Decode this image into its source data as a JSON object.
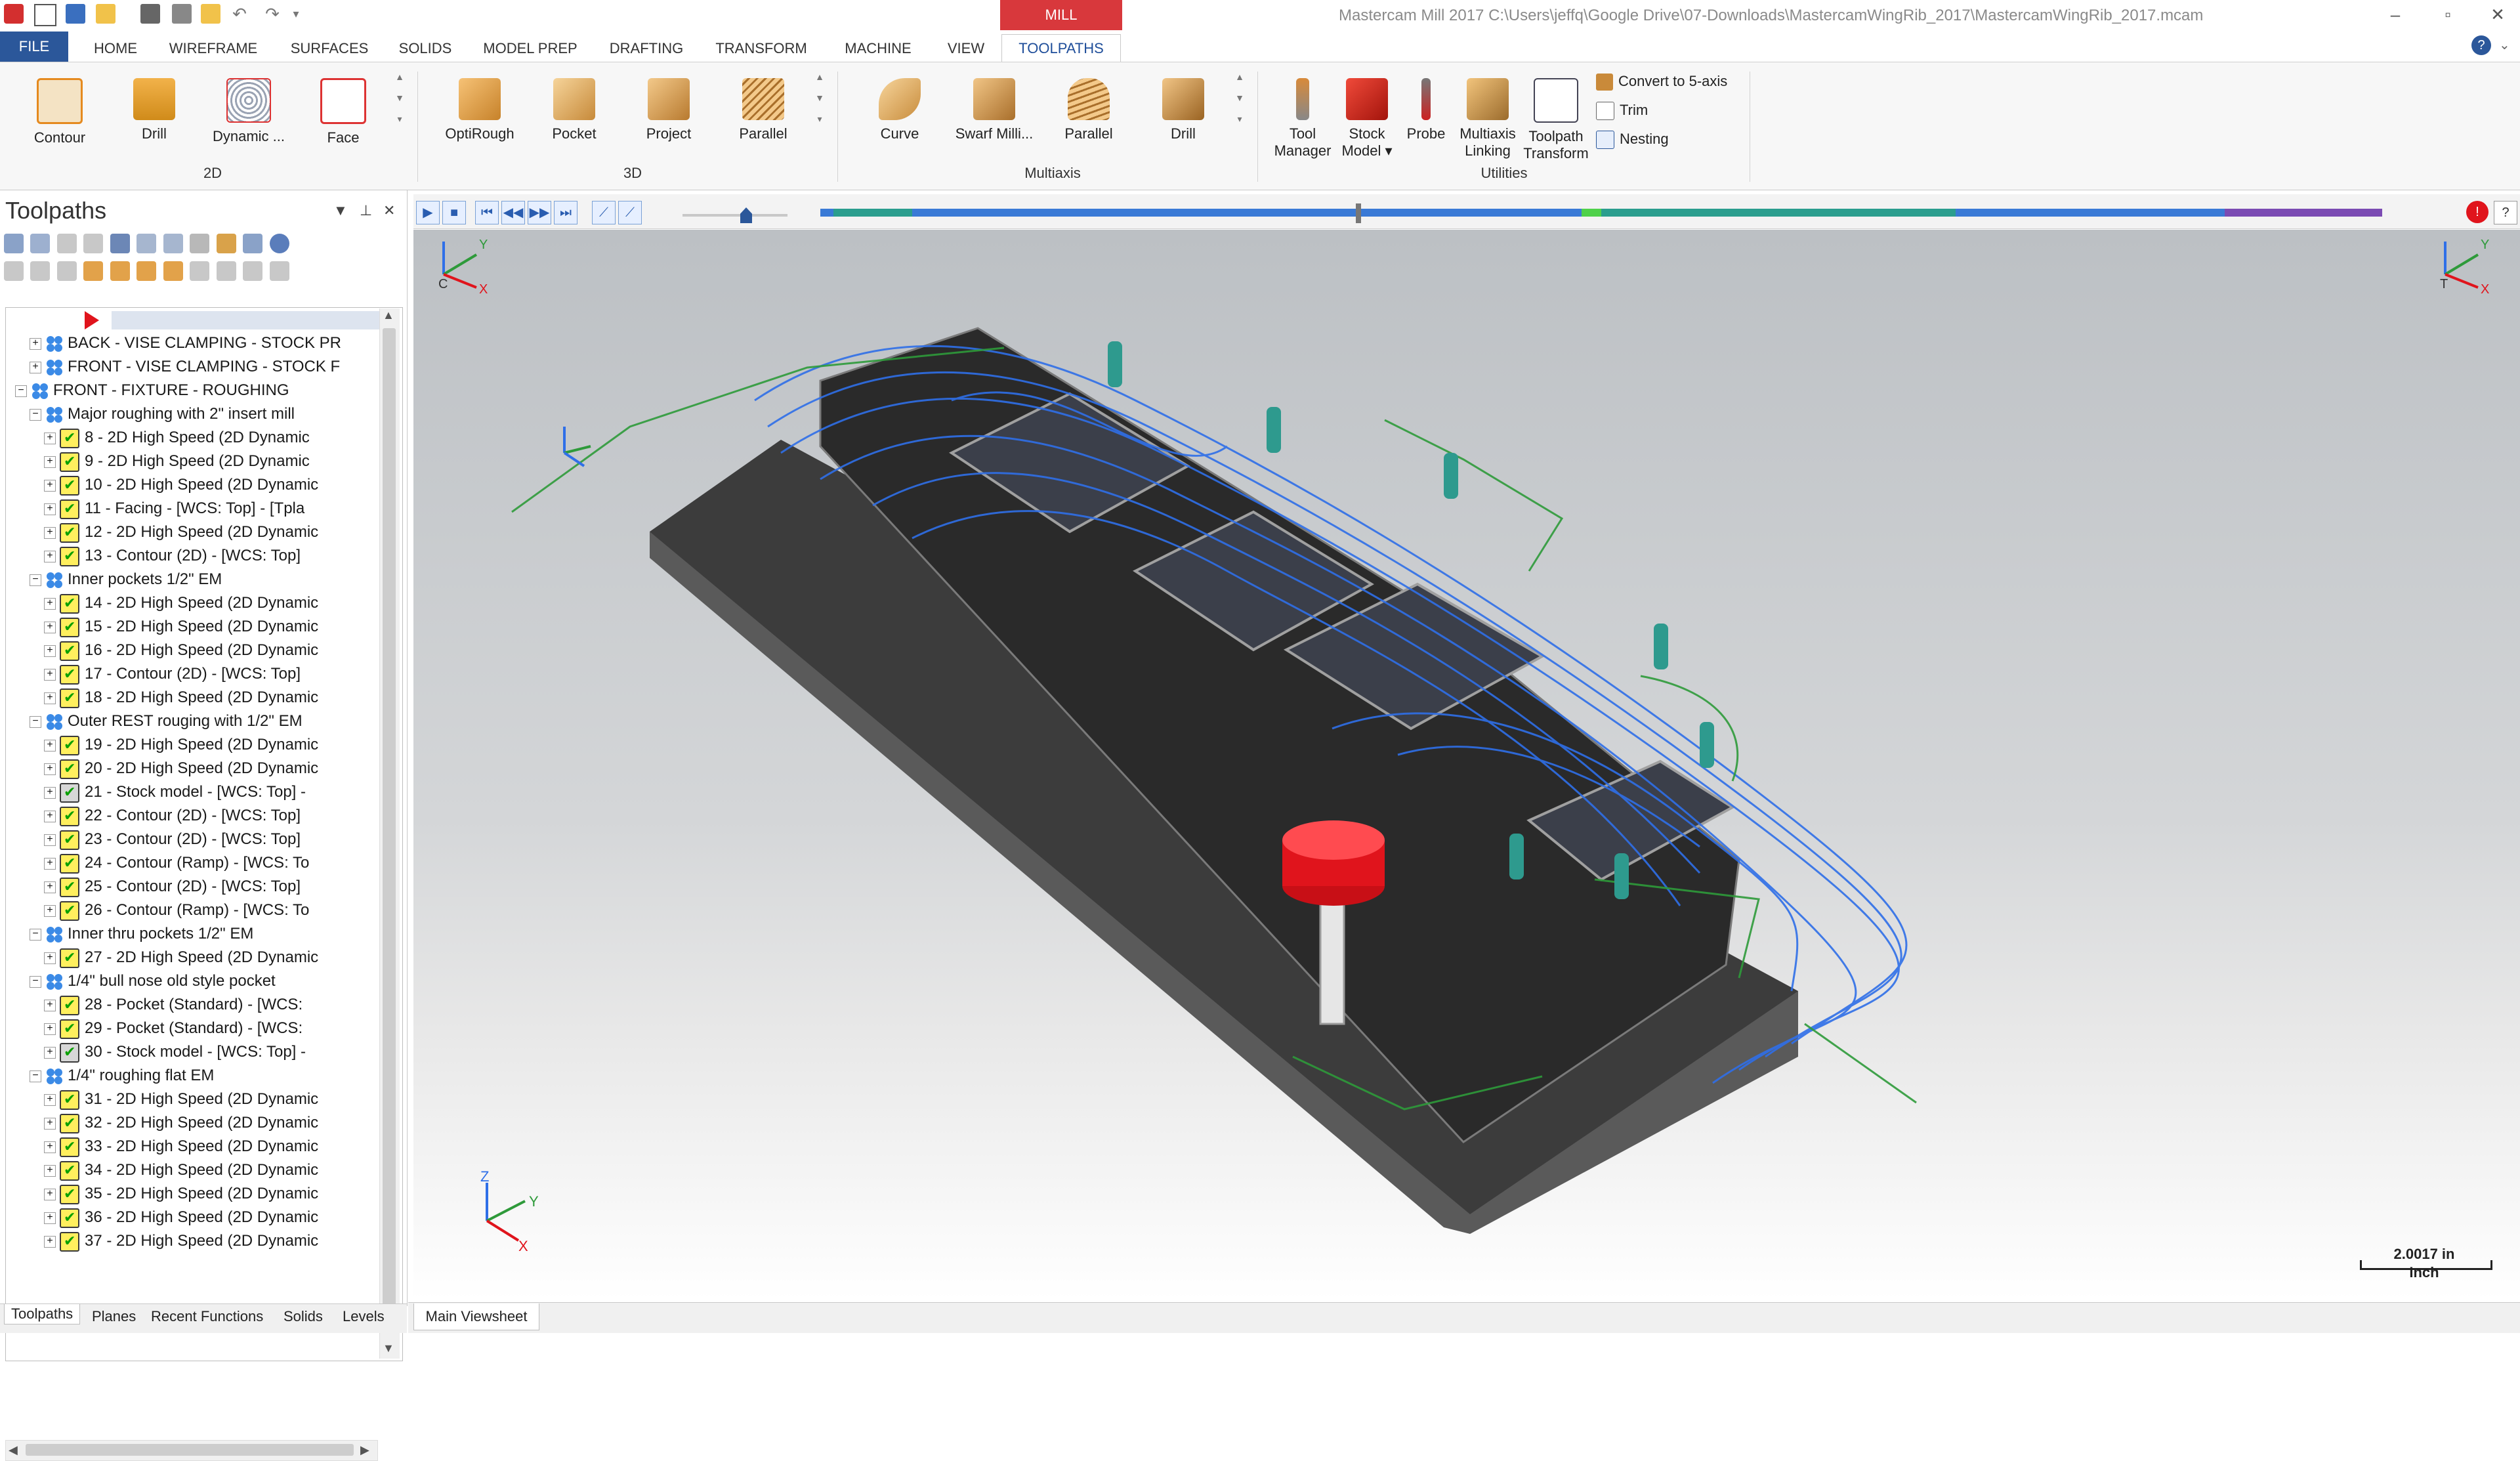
{
  "window": {
    "title": "Mastercam Mill 2017  C:\\Users\\jeffq\\Google Drive\\07-Downloads\\MastercamWingRib_2017\\MastercamWingRib_2017.mcam",
    "context_tab": "MILL"
  },
  "ribbon_tabs": [
    "FILE",
    "HOME",
    "WIREFRAME",
    "SURFACES",
    "SOLIDS",
    "MODEL PREP",
    "DRAFTING",
    "TRANSFORM",
    "MACHINE",
    "VIEW",
    "TOOLPATHS"
  ],
  "active_tab": "TOOLPATHS",
  "ribbon": {
    "group_2d": {
      "label": "2D",
      "buttons": [
        "Contour",
        "Drill",
        "Dynamic ...",
        "Face"
      ]
    },
    "group_3d": {
      "label": "3D",
      "buttons": [
        "OptiRough",
        "Pocket",
        "Project",
        "Parallel"
      ]
    },
    "group_multiaxis": {
      "label": "Multiaxis",
      "buttons": [
        "Curve",
        "Swarf Milli...",
        "Parallel",
        "Drill"
      ]
    },
    "group_utilities": {
      "label": "Utilities",
      "buttons": [
        {
          "line1": "Tool",
          "line2": "Manager"
        },
        {
          "line1": "Stock",
          "line2": "Model ▾"
        },
        {
          "line1": "Probe",
          "line2": ""
        },
        {
          "line1": "Multiaxis",
          "line2": "Linking"
        },
        {
          "line1": "Toolpath",
          "line2": "Transform"
        }
      ],
      "small": [
        "Convert to 5-axis",
        "Trim",
        "Nesting"
      ]
    }
  },
  "panel": {
    "title": "Toolpaths",
    "tree": [
      {
        "level": 2,
        "kind": "group",
        "label": "BACK - VISE CLAMPING - STOCK PR"
      },
      {
        "level": 2,
        "kind": "group",
        "label": "FRONT - VISE CLAMPING - STOCK F"
      },
      {
        "level": 1,
        "kind": "group",
        "label": "FRONT - FIXTURE - ROUGHING"
      },
      {
        "level": 2,
        "kind": "group",
        "label": "Major roughing with 2\" insert mill"
      },
      {
        "level": 3,
        "kind": "op",
        "label": "8 - 2D High Speed (2D Dynamic"
      },
      {
        "level": 3,
        "kind": "op",
        "label": "9 - 2D High Speed (2D Dynamic"
      },
      {
        "level": 3,
        "kind": "op",
        "label": "10 - 2D High Speed (2D Dynamic"
      },
      {
        "level": 3,
        "kind": "op",
        "label": "11 - Facing - [WCS: Top] - [Tpla"
      },
      {
        "level": 3,
        "kind": "op",
        "label": "12 - 2D High Speed (2D Dynamic"
      },
      {
        "level": 3,
        "kind": "op",
        "label": "13 - Contour (2D) - [WCS: Top]"
      },
      {
        "level": 2,
        "kind": "group",
        "label": "Inner pockets 1/2\" EM"
      },
      {
        "level": 3,
        "kind": "op",
        "label": "14 - 2D High Speed (2D Dynamic"
      },
      {
        "level": 3,
        "kind": "op",
        "label": "15 - 2D High Speed (2D Dynamic"
      },
      {
        "level": 3,
        "kind": "op",
        "label": "16 - 2D High Speed (2D Dynamic"
      },
      {
        "level": 3,
        "kind": "op",
        "label": "17 - Contour (2D) - [WCS: Top]"
      },
      {
        "level": 3,
        "kind": "op",
        "label": "18 - 2D High Speed (2D Dynamic"
      },
      {
        "level": 2,
        "kind": "group",
        "label": "Outer REST rouging with 1/2\" EM"
      },
      {
        "level": 3,
        "kind": "op",
        "label": "19 - 2D High Speed (2D Dynamic"
      },
      {
        "level": 3,
        "kind": "op",
        "label": "20 - 2D High Speed (2D Dynamic"
      },
      {
        "level": 3,
        "kind": "stock",
        "label": "21 - Stock model - [WCS: Top] -"
      },
      {
        "level": 3,
        "kind": "op",
        "label": "22 - Contour (2D) - [WCS: Top]"
      },
      {
        "level": 3,
        "kind": "op",
        "label": "23 - Contour (2D) - [WCS: Top]"
      },
      {
        "level": 3,
        "kind": "op",
        "label": "24 - Contour (Ramp) - [WCS: To"
      },
      {
        "level": 3,
        "kind": "op",
        "label": "25 - Contour (2D) - [WCS: Top]"
      },
      {
        "level": 3,
        "kind": "op",
        "label": "26 - Contour (Ramp) - [WCS: To"
      },
      {
        "level": 2,
        "kind": "group",
        "label": "Inner thru pockets 1/2\" EM"
      },
      {
        "level": 3,
        "kind": "op",
        "label": "27 - 2D High Speed (2D Dynamic"
      },
      {
        "level": 2,
        "kind": "group",
        "label": "1/4\" bull nose old style pocket"
      },
      {
        "level": 3,
        "kind": "op",
        "label": "28 - Pocket (Standard) - [WCS:"
      },
      {
        "level": 3,
        "kind": "op",
        "label": "29 - Pocket (Standard) - [WCS:"
      },
      {
        "level": 3,
        "kind": "stock",
        "label": "30 - Stock model - [WCS: Top] -"
      },
      {
        "level": 2,
        "kind": "group",
        "label": "1/4\" roughing flat EM"
      },
      {
        "level": 3,
        "kind": "op",
        "label": "31 - 2D High Speed (2D Dynamic"
      },
      {
        "level": 3,
        "kind": "op",
        "label": "32 - 2D High Speed (2D Dynamic"
      },
      {
        "level": 3,
        "kind": "op",
        "label": "33 - 2D High Speed (2D Dynamic"
      },
      {
        "level": 3,
        "kind": "op",
        "label": "34 - 2D High Speed (2D Dynamic"
      },
      {
        "level": 3,
        "kind": "op",
        "label": "35 - 2D High Speed (2D Dynamic"
      },
      {
        "level": 3,
        "kind": "op",
        "label": "36 - 2D High Speed (2D Dynamic"
      },
      {
        "level": 3,
        "kind": "op",
        "label": "37 - 2D High Speed (2D Dynamic"
      }
    ]
  },
  "bottom_tabs": [
    "Toolpaths",
    "Planes",
    "Recent Functions",
    "Solids",
    "Levels"
  ],
  "active_bottom_tab": "Toolpaths",
  "viewsheet_tab": "Main Viewsheet",
  "viewport": {
    "scale_value": "2.0017 in",
    "scale_unit": "Inch",
    "axis_labels": {
      "x": "X",
      "y": "Y",
      "z": "Z",
      "top_left_origin": "C",
      "top_right_origin": "T"
    }
  },
  "colors": {
    "file_tab": "#2b579a",
    "mill_tab": "#d8383c",
    "toolpath_blue": "#2f6fe8",
    "toolpath_green": "#2e9a3a",
    "tool_red": "#e0141c"
  }
}
